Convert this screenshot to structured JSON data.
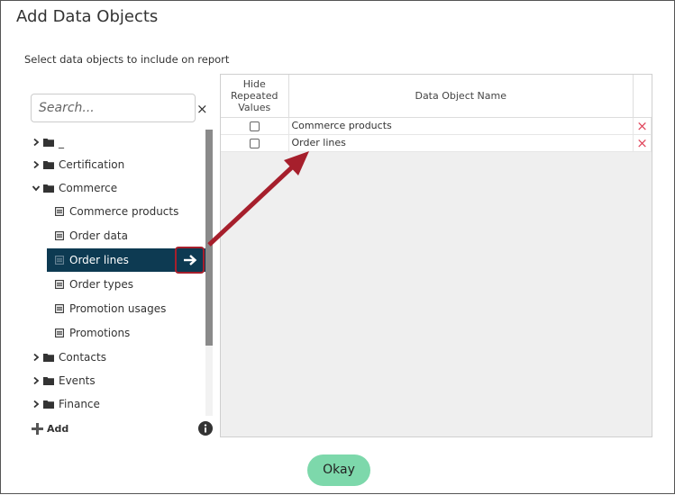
{
  "dialog": {
    "title": "Add Data Objects",
    "instruction": "Select data objects to include on report"
  },
  "search": {
    "placeholder": "Search...",
    "clear_label": "×"
  },
  "tree": {
    "items": [
      {
        "label": "_",
        "type": "folder",
        "expanded": false
      },
      {
        "label": "Certification",
        "type": "folder",
        "expanded": false
      },
      {
        "label": "Commerce",
        "type": "folder",
        "expanded": true
      },
      {
        "label": "Commerce products",
        "type": "object"
      },
      {
        "label": "Order data",
        "type": "object"
      },
      {
        "label": "Order lines",
        "type": "object",
        "selected": true
      },
      {
        "label": "Order types",
        "type": "object"
      },
      {
        "label": "Promotion usages",
        "type": "object"
      },
      {
        "label": "Promotions",
        "type": "object"
      },
      {
        "label": "Contacts",
        "type": "folder",
        "expanded": false
      },
      {
        "label": "Events",
        "type": "folder",
        "expanded": false
      },
      {
        "label": "Finance",
        "type": "folder",
        "expanded": false
      }
    ],
    "add_label": "Add"
  },
  "table": {
    "headers": {
      "hide_repeated": "Hide Repeated Values",
      "name": "Data Object Name"
    },
    "rows": [
      {
        "hide_repeated": false,
        "name": "Commerce products",
        "delete_icon": "×"
      },
      {
        "hide_repeated": false,
        "name": "Order lines",
        "delete_icon": "×"
      }
    ]
  },
  "buttons": {
    "okay": "Okay"
  },
  "colors": {
    "selected_bg": "#0d3a52",
    "okay_bg": "#7dd8ab",
    "delete_red": "#e0455b",
    "callout_red": "#a61f2c"
  },
  "icons": {
    "folder": "folder-icon",
    "object": "table-doc-icon",
    "expand": "chevron-right-icon",
    "collapse": "chevron-down-icon",
    "move": "arrow-right-icon",
    "info": "info-icon",
    "add": "plus-icon"
  }
}
